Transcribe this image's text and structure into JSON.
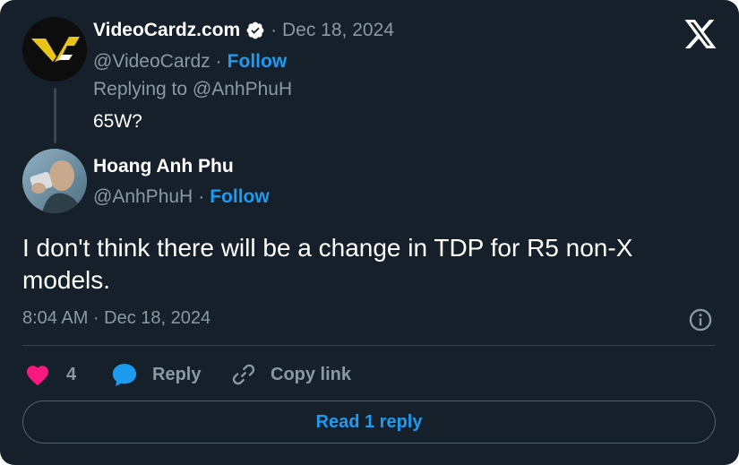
{
  "parent_tweet": {
    "display_name": "VideoCardz.com",
    "verified": true,
    "date": "Dec 18, 2024",
    "handle": "@VideoCardz",
    "follow_label": "Follow",
    "replying_to": "Replying to @AnhPhuH",
    "text": "65W?"
  },
  "reply_tweet": {
    "display_name": "Hoang Anh Phu",
    "handle": "@AnhPhuH",
    "follow_label": "Follow",
    "text": "I don't think there will be a change in TDP for R5 non-X models.",
    "timestamp": "8:04 AM · Dec 18, 2024"
  },
  "actions": {
    "like_count": "4",
    "reply_label": "Reply",
    "copy_link_label": "Copy link"
  },
  "read_replies_label": "Read 1 reply",
  "icons": {
    "close": "x-logo-icon",
    "verified": "verified-badge-icon",
    "info": "info-icon",
    "like": "heart-icon",
    "reply": "speech-bubble-icon",
    "copy": "link-icon"
  },
  "colors": {
    "background": "#15202b",
    "accent": "#1d9bf0",
    "like": "#f91880",
    "muted_text": "#8b98a5"
  },
  "separator": "·"
}
